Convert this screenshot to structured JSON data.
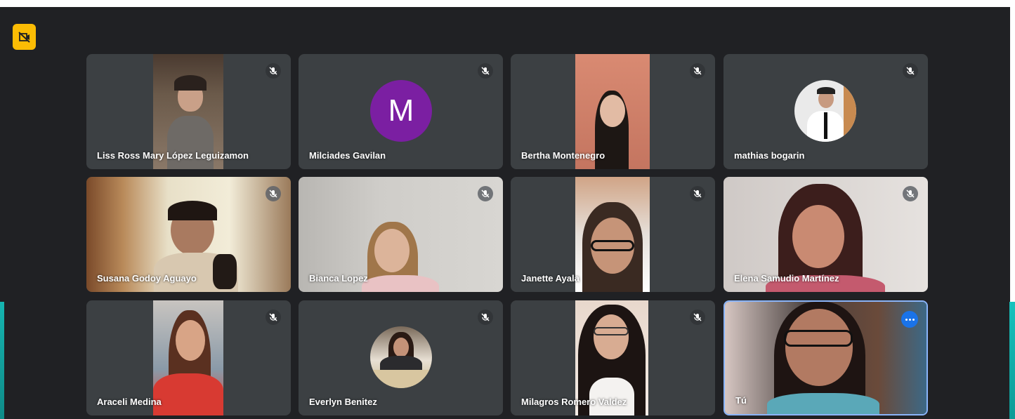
{
  "participants": [
    {
      "name": "Liss Ross Mary López Leguizamon"
    },
    {
      "name": "Milciades Gavilan",
      "avatar_letter": "M"
    },
    {
      "name": "Bertha Montenegro"
    },
    {
      "name": "mathias bogarin"
    },
    {
      "name": "Susana Godoy Aguayo"
    },
    {
      "name": "Bianca Lopez"
    },
    {
      "name": "Janette Ayala"
    },
    {
      "name": "Elena Samudio Martínez"
    },
    {
      "name": "Araceli Medina"
    },
    {
      "name": "Everlyn Benitez"
    },
    {
      "name": "Milagros Romero Valdez"
    },
    {
      "name": "Tú"
    }
  ],
  "icons": {
    "badge": "camera-off-icon",
    "mic": "mic-off-icon",
    "more": "more-options-icon"
  },
  "colors": {
    "background": "#202124",
    "tile": "#3c4043",
    "badge": "#fbbc04",
    "avatar": "#7b1fa2",
    "self_border": "#8ab4f8",
    "more_button": "#1a73e8"
  }
}
